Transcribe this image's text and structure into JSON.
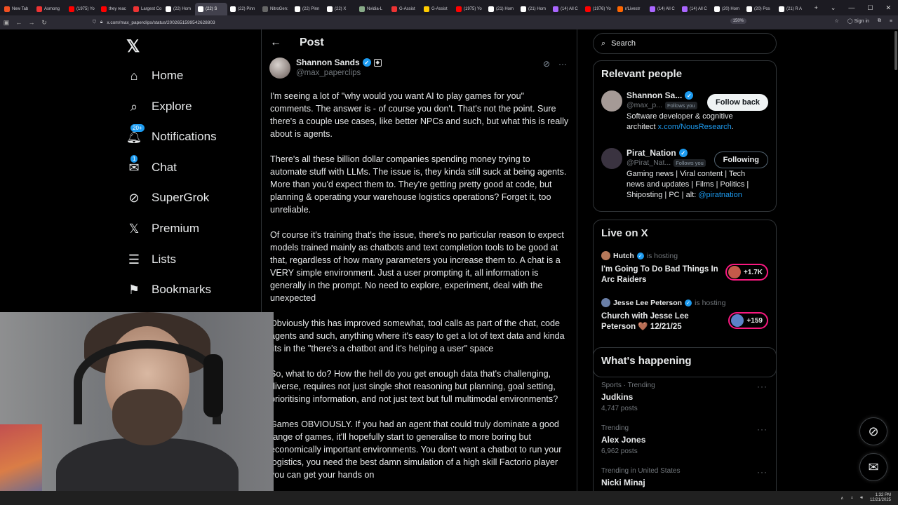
{
  "browser": {
    "tabs": [
      {
        "label": "New Tab",
        "color": "#f25022"
      },
      {
        "label": "Asmong",
        "color": "#e33"
      },
      {
        "label": "(1975) Yo",
        "color": "#f00"
      },
      {
        "label": "they reac",
        "color": "#f00"
      },
      {
        "label": "Largest Co",
        "color": "#e33"
      },
      {
        "label": "(22) Hom",
        "color": "#fff"
      },
      {
        "label": "(22) S",
        "color": "#fff"
      },
      {
        "label": "(22) Pinn",
        "color": "#fff"
      },
      {
        "label": "NitroGen:",
        "color": "#666"
      },
      {
        "label": "(22) Pinn",
        "color": "#fff"
      },
      {
        "label": "(22) X",
        "color": "#fff"
      },
      {
        "label": "Nvidia-L",
        "color": "#8a8"
      },
      {
        "label": "G-Assist",
        "color": "#e33"
      },
      {
        "label": "G-Assist",
        "color": "#fc0"
      },
      {
        "label": "(1975) Yo",
        "color": "#f00"
      },
      {
        "label": "(21) Hom",
        "color": "#fff"
      },
      {
        "label": "(21) Hom",
        "color": "#fff"
      },
      {
        "label": "(14) All C",
        "color": "#a6f"
      },
      {
        "label": "(1976) Yo",
        "color": "#f00"
      },
      {
        "label": "r/Livestr",
        "color": "#f60"
      },
      {
        "label": "(14) All C",
        "color": "#a6f"
      },
      {
        "label": "(14) All C",
        "color": "#a6f"
      },
      {
        "label": "(20) Hom",
        "color": "#fff"
      },
      {
        "label": "(20) Pos",
        "color": "#fff"
      },
      {
        "label": "(21) R A",
        "color": "#fff"
      }
    ],
    "active_tab_index": 6,
    "url": "x.com/max_paperclips/status/2002651599542628803",
    "zoom": "150%",
    "sign_in": "Sign in"
  },
  "leftnav": {
    "items": [
      {
        "name": "home",
        "label": "Home",
        "icon": "home-icon"
      },
      {
        "name": "explore",
        "label": "Explore",
        "icon": "search-icon"
      },
      {
        "name": "notifications",
        "label": "Notifications",
        "icon": "bell-icon",
        "badge": "20+"
      },
      {
        "name": "chat",
        "label": "Chat",
        "icon": "mail-icon",
        "badge": "1"
      },
      {
        "name": "supergrok",
        "label": "SuperGrok",
        "icon": "grok-icon"
      },
      {
        "name": "premium",
        "label": "Premium",
        "icon": "x-logo-icon"
      },
      {
        "name": "lists",
        "label": "Lists",
        "icon": "list-icon"
      },
      {
        "name": "bookmarks",
        "label": "Bookmarks",
        "icon": "bookmark-icon"
      }
    ]
  },
  "post": {
    "header_title": "Post",
    "author_name": "Shannon Sands",
    "author_handle": "@max_paperclips",
    "paragraphs": [
      "I'm seeing a lot of \"why would you want AI to play games for you\" comments. The answer is - of course you don't. That's not the point. Sure there's a couple use cases, like better NPCs and such, but what this is really about is agents.",
      "There's all these billion dollar companies spending money trying to automate stuff with LLMs. The issue is, they kinda still suck at being agents. More than you'd expect them to. They're getting pretty good at code, but planning & operating your warehouse logistics operations? Forget it, too unreliable.",
      "Of course it's training that's the issue, there's no particular reason to expect models trained mainly as chatbots and text completion tools to be good at that, regardless of how many parameters you increase them to. A chat is a VERY simple environment. Just a user prompting it, all information is generally in the prompt. No need to explore, experiment, deal with the unexpected",
      "Obviously this has improved somewhat, tool calls as part of the chat, code agents and such, anything where it's easy to get a lot of text data and kinda fits in the \"there's a chatbot and it's helping a user\" space",
      "So, what to do? How the hell do you get enough data that's challenging, diverse, requires not just single shot reasoning but planning, goal setting, prioritising information, and not just text but full multimodal environments?",
      "Games OBVIOUSLY. If you had an agent that could truly dominate a good range of games, it'll hopefully start to generalise to more boring but economically important environments. You don't want a chatbot to run your logistics, you need the best damn simulation of a high skill Factorio player you can get your hands on"
    ]
  },
  "right": {
    "search_placeholder": "Search",
    "relevant_title": "Relevant people",
    "people": [
      {
        "name": "Shannon Sa...",
        "handle": "@max_p...",
        "follows": "Follows you",
        "bio": "Software developer & cognitive architect ",
        "bio_link": "x.com/NousResearch",
        "bio_tail": ".",
        "button": "Follow back",
        "avatar_color": "#a59a96"
      },
      {
        "name": "Pirat_Nation",
        "handle": "@Pirat_Nat...",
        "follows": "Follows you",
        "bio": "Gaming news | Viral content | Tech news and updates | Films | Politics | Shiposting | PC | alt: ",
        "bio_link": "@piratnation",
        "bio_tail": "",
        "button": "Following",
        "avatar_color": "#3a3340"
      }
    ],
    "live_title": "Live on X",
    "live": [
      {
        "host": "Hutch",
        "hosting": "is hosting",
        "title": "I'm Going To Do Bad Things In Arc Raiders",
        "count": "+1.7K",
        "host_color": "#b7795a",
        "count_color": "#c55a4a"
      },
      {
        "host": "Jesse Lee Peterson",
        "hosting": "is hosting",
        "title": "Church with Jesse Lee Peterson 🤎 12/21/25",
        "count": "+159",
        "host_color": "#6a7fa8",
        "count_color": "#5b82c8"
      }
    ],
    "happening_title": "What's happening",
    "trends": [
      {
        "meta": "Sports · Trending",
        "name": "Judkins",
        "posts": "4,747 posts"
      },
      {
        "meta": "Trending",
        "name": "Alex Jones",
        "posts": "6,962 posts"
      },
      {
        "meta": "Trending in United States",
        "name": "Nicki Minaj",
        "posts": ""
      }
    ]
  },
  "taskbar": {
    "time": "1:32 PM",
    "date": "12/21/2025"
  }
}
